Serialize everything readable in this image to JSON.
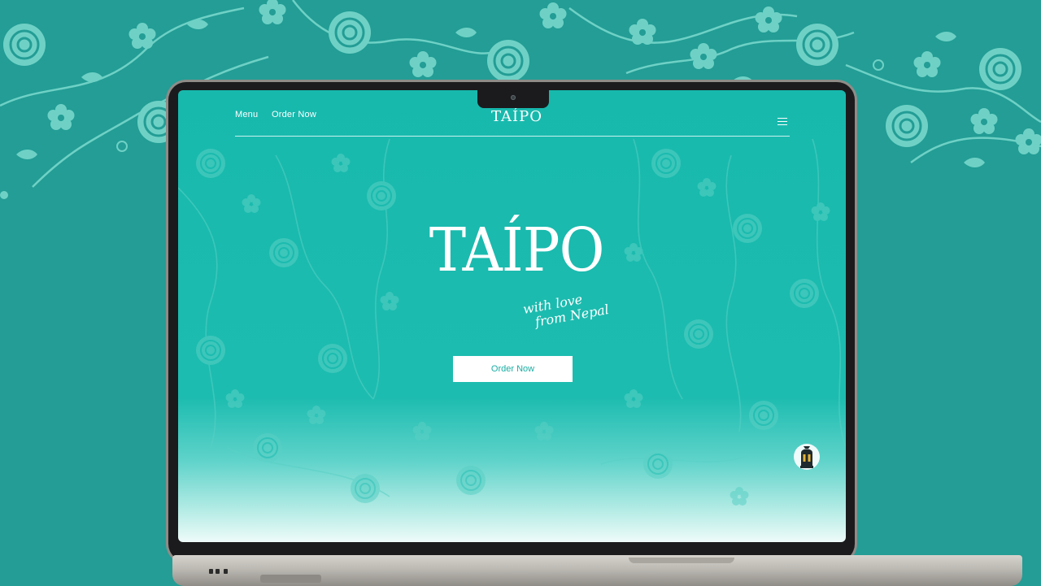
{
  "site": {
    "brand_logo": "TAÍPO",
    "nav": {
      "menu_label": "Menu",
      "order_label": "Order Now"
    },
    "hero": {
      "title": "TAÍPO",
      "tagline_line1": "with love",
      "tagline_line2": "from Nepal",
      "cta_label": "Order Now"
    },
    "icons": {
      "menu": "hamburger-menu-icon",
      "chat": "lantern-chat-icon",
      "camera": "camera-icon"
    }
  },
  "colors": {
    "background": "#239d95",
    "screen_teal": "#1dbcb0",
    "pattern": "#5cc9bf",
    "cta_text": "#1aaea3",
    "white": "#ffffff"
  }
}
